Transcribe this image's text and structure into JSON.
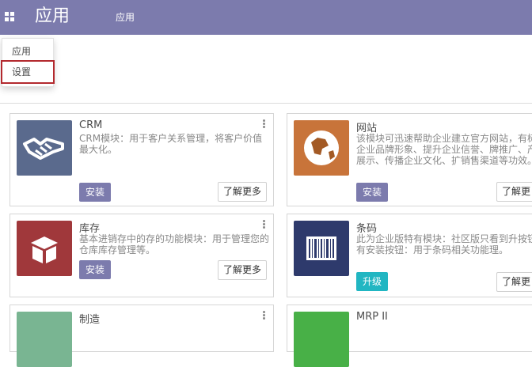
{
  "header": {
    "brand": "应用",
    "menu_link": "应用"
  },
  "dropdown": {
    "items": [
      "应用",
      "设置"
    ]
  },
  "apps": [
    {
      "name": "CRM",
      "description": "CRM模块：用于客户关系管理，将客户价值最大化。",
      "action": "安装",
      "more": "了解更多",
      "icon": "handshake-icon",
      "color": "#5a6a8d"
    },
    {
      "name": "网站",
      "description": "该模块可迅速帮助企业建立官方网站，有树立企业品牌形象、提升企业信誉、牌推广、产品展示、传播企业文化、扩销售渠道等功效。",
      "action": "安装",
      "more": "了解更",
      "icon": "globe-icon",
      "color": "#c8743a"
    },
    {
      "name": "库存",
      "description": "基本进销存中的存的功能模块：用于管理您的仓库库存管理等。",
      "action": "安装",
      "more": "了解更多",
      "icon": "box-icon",
      "color": "#a0383b"
    },
    {
      "name": "条码",
      "description": "此为企业版特有模块：社区版只看到升按钮没有安装按钮：用于条码相关功能理。",
      "action": "升级",
      "more": "了解更",
      "icon": "barcode-icon",
      "color": "#2e3a6c"
    },
    {
      "name": "制造",
      "icon": "manufacturing-icon",
      "color": "#79b592"
    },
    {
      "name": "MRP II",
      "icon": "mrp-icon",
      "color": "#48b047"
    }
  ],
  "colors": {
    "topbar": "#7c7bad",
    "primary_button": "#7c7bad",
    "upgrade_button": "#21b6c2",
    "highlight_border": "#b3292e"
  }
}
